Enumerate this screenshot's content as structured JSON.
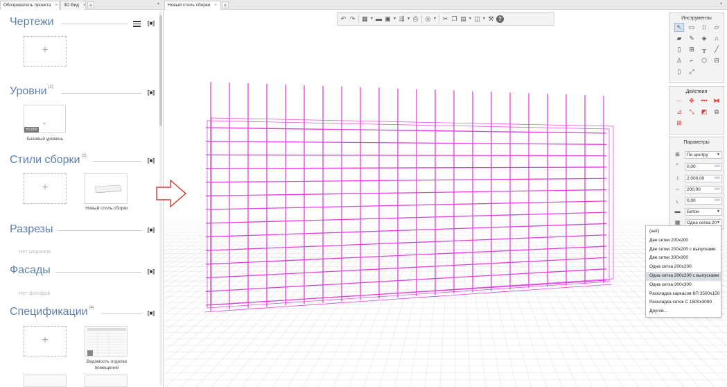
{
  "tabs": {
    "project_browser": "Обозреватель проекта",
    "view_3d": "3D Вид",
    "new_style": "Новый стиль сборки",
    "close_glyph": "×",
    "add_glyph": "+",
    "menu_glyph": "▾"
  },
  "left_panel": {
    "drawings": {
      "title": "Чертежи",
      "add_glyph": "+"
    },
    "levels": {
      "title": "Уровни",
      "count": "(1)",
      "items": [
        {
          "label": "Базовый уровень",
          "badge": "±0,000"
        }
      ]
    },
    "assembly_styles": {
      "title": "Стили сборки",
      "count": "(1)",
      "add_glyph": "+",
      "items": [
        {
          "label": "Новый стиль сборки"
        }
      ]
    },
    "sections": {
      "title": "Разрезы",
      "empty_text": "Нет разрезов"
    },
    "facades": {
      "title": "Фасады",
      "empty_text": "Нет фасадов"
    },
    "specifications": {
      "title": "Спецификации",
      "count": "(4)",
      "add_glyph": "+",
      "items": [
        {
          "label": "Ведомость отделки помещений"
        }
      ]
    },
    "section_button_glyph": "[■]"
  },
  "toolbar": {
    "items": [
      "undo-icon",
      "redo-icon",
      "new-icon",
      "open-folder-icon",
      "save-icon",
      "export-icon",
      "print-icon",
      "render-icon",
      "cut-icon",
      "copy-icon",
      "paste-icon",
      "view-cube-icon",
      "wrench-icon",
      "help-icon"
    ]
  },
  "tools_panel": {
    "title": "Инструменты",
    "icons": [
      "select-icon",
      "rectangle-icon",
      "bracket-icon",
      "slab-icon",
      "wall-icon",
      "pencil-icon",
      "beam-icon",
      "roof-icon",
      "door-icon",
      "window-icon",
      "railing-icon",
      "line-icon",
      "person-icon",
      "pipe-icon",
      "shield-icon",
      "column-icon",
      "column-tag-icon",
      "dimension-icon"
    ]
  },
  "actions_panel": {
    "title": "Действия",
    "icons": [
      "move-icon",
      "rotate-icon",
      "array-icon",
      "mirror-icon",
      "stretch-icon",
      "scale-icon",
      "trim-icon",
      "offset-icon",
      "explode-icon"
    ]
  },
  "params_panel": {
    "title": "Параметры",
    "alignment": "По центру",
    "field1": "0,00",
    "field2": "2 000,00",
    "field3": "200,00",
    "field4": "0,00",
    "unit": "мм",
    "material": "Бетон",
    "reinforcement": "Одна сетка 20"
  },
  "reinforcement_dropdown": {
    "options": [
      "(нет)",
      "Две сетки 200х200",
      "Две сетки 200х200 с выпусками",
      "Две сетки 300х300",
      "Одна сетка 200х200",
      "Одна сетка 200х200 с выпусками",
      "Одна сетка 300х300",
      "Раскладка каркасов КП 3500х150",
      "Раскладка сеток С 1500х3000",
      "Другой..."
    ],
    "highlighted_index": 5
  },
  "colors": {
    "title_blue": "#5d7fae",
    "mesh_magenta": "#e040e0",
    "arrow_red": "#d23b2b"
  }
}
